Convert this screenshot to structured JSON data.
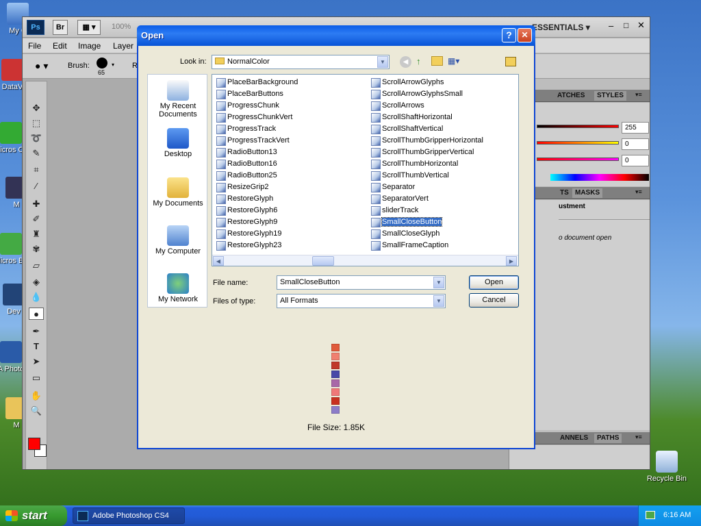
{
  "desktop": {
    "icons": [
      {
        "label": "My C"
      },
      {
        "label": "DataV"
      },
      {
        "label": "Micros C+"
      },
      {
        "label": "M"
      },
      {
        "label": "Micros Ba"
      },
      {
        "label": "Dev"
      },
      {
        "label": "A Photo"
      },
      {
        "label": "M"
      }
    ],
    "recycle_bin": "Recycle Bin"
  },
  "photoshop": {
    "logo": "Ps",
    "bridge": "Br",
    "zoom": "100%",
    "workspace": "ESSENTIALS",
    "menu": [
      "File",
      "Edit",
      "Image",
      "Layer"
    ],
    "options": {
      "brush_label": "Brush:",
      "brush_size": "65",
      "r_label": "R"
    },
    "panels": {
      "tabs1": [
        "ATCHES",
        "STYLES"
      ],
      "color_values": [
        "255",
        "0",
        "0"
      ],
      "tabs2": [
        "TS",
        "MASKS"
      ],
      "adjust_title": "ustment",
      "no_doc": "o document open",
      "tabs3": [
        "ANNELS",
        "PATHS"
      ]
    },
    "colors": {
      "foreground": "#ff0000",
      "background": "#ffffff"
    }
  },
  "dialog": {
    "title": "Open",
    "help": "?",
    "close": "✕",
    "look_in_label": "Look in:",
    "look_in_value": "NormalColor",
    "places": [
      "My Recent Documents",
      "Desktop",
      "My Documents",
      "My Computer",
      "My Network"
    ],
    "files_col1": [
      "PlaceBarBackground",
      "PlaceBarButtons",
      "ProgressChunk",
      "ProgressChunkVert",
      "ProgressTrack",
      "ProgressTrackVert",
      "RadioButton13",
      "RadioButton16",
      "RadioButton25",
      "ResizeGrip2",
      "RestoreGlyph",
      "RestoreGlyph6",
      "RestoreGlyph9",
      "RestoreGlyph19",
      "RestoreGlyph23"
    ],
    "files_col2": [
      "ScrollArrowGlyphs",
      "ScrollArrowGlyphsSmall",
      "ScrollArrows",
      "ScrollShaftHorizontal",
      "ScrollShaftVertical",
      "ScrollThumbGripperHorizontal",
      "ScrollThumbGripperVertical",
      "ScrollThumbHorizontal",
      "ScrollThumbVertical",
      "Separator",
      "SeparatorVert",
      "sliderTrack",
      "SmallCloseButton",
      "SmallCloseGlyph",
      "SmallFrameCaption"
    ],
    "selected_file": "SmallCloseButton",
    "file_name_label": "File name:",
    "file_name_value": "SmallCloseButton",
    "files_type_label": "Files of type:",
    "files_type_value": "All Formats",
    "open_button": "Open",
    "cancel_button": "Cancel",
    "file_size": "File Size: 1.85K",
    "preview_colors": [
      "#e05a3a",
      "#f08070",
      "#c03828",
      "#4848a8",
      "#a868a8",
      "#f07878",
      "#c83020",
      "#8c7cc8"
    ]
  },
  "taskbar": {
    "start": "start",
    "task": "Adobe Photoshop CS4",
    "clock": "6:16 AM"
  }
}
